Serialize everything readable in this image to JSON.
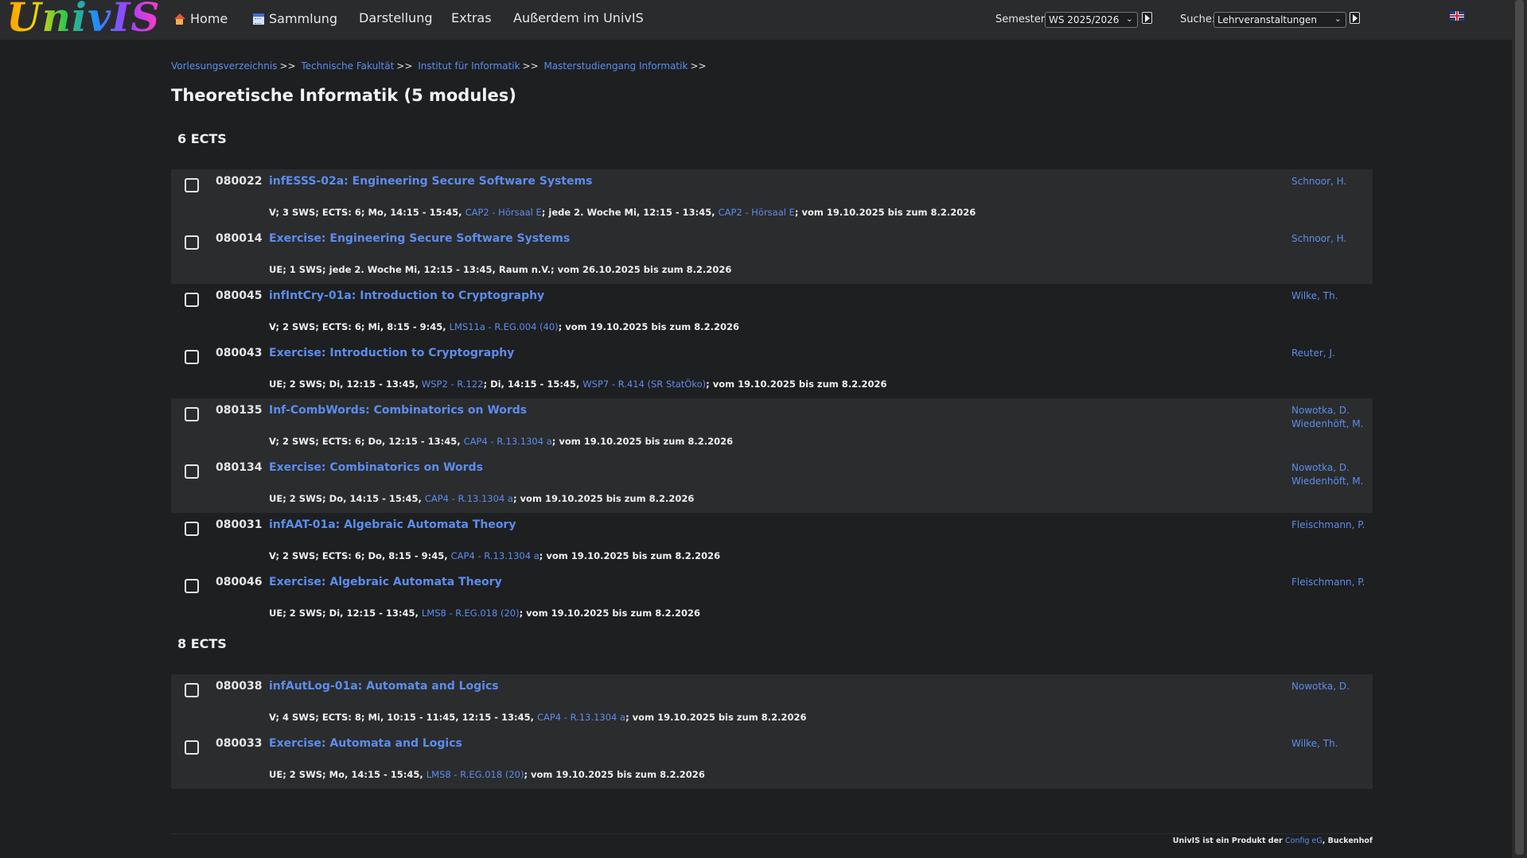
{
  "app": {
    "logo_text": "UnivIS"
  },
  "nav": {
    "items": [
      {
        "label": "Home",
        "icon": "home-icon"
      },
      {
        "label": "Sammlung",
        "icon": "calendar-icon"
      },
      {
        "label": "Darstellung"
      },
      {
        "label": "Extras"
      },
      {
        "label": "Außerdem im UnivIS"
      }
    ],
    "semester_label": "Semester:",
    "semester_value": "WS 2025/2026",
    "search_label": "Suche:",
    "search_value": "Lehrveranstaltungen",
    "language_flag": "uk-flag-icon"
  },
  "breadcrumb": [
    "Vorlesungsverzeichnis",
    "Technische Fakultät",
    "Institut für Informatik",
    "Masterstudiengang Informatik"
  ],
  "breadcrumb_sep": ">>",
  "page_title": "Theoretische Informatik (5 modules)",
  "groups": [
    {
      "heading": "6 ECTS",
      "courses": [
        {
          "number": "080022",
          "title": "infESSS-02a: Engineering Secure Software Systems",
          "lecturers": [
            "Schnoor, H."
          ],
          "details": [
            {
              "t": "V; 3 SWS; ECTS: 6; Mo, 14:15 - 15:45, "
            },
            {
              "t": "CAP2 - Hörsaal E",
              "room": true
            },
            {
              "t": "; jede 2. Woche Mi, 12:15 - 13:45, "
            },
            {
              "t": "CAP2 - Hörsaal E",
              "room": true
            },
            {
              "t": "; vom 19.10.2025 bis zum 8.2.2026"
            }
          ]
        },
        {
          "number": "080014",
          "title": "Exercise: Engineering Secure Software Systems",
          "lecturers": [
            "Schnoor, H."
          ],
          "details": [
            {
              "t": "UE; 1 SWS; jede 2. Woche Mi, 12:15 - 13:45, Raum n.V.; vom 26.10.2025 bis zum 8.2.2026"
            }
          ]
        },
        {
          "number": "080045",
          "title": "infIntCry-01a: Introduction to Cryptography",
          "lecturers": [
            "Wilke, Th."
          ],
          "details": [
            {
              "t": "V; 2 SWS; ECTS: 6; Mi, 8:15 - 9:45, "
            },
            {
              "t": "LMS11a - R.EG.004 (40)",
              "room": true
            },
            {
              "t": "; vom 19.10.2025 bis zum 8.2.2026"
            }
          ]
        },
        {
          "number": "080043",
          "title": "Exercise: Introduction to Cryptography",
          "lecturers": [
            "Reuter, J."
          ],
          "details": [
            {
              "t": "UE; 2 SWS; Di, 12:15 - 13:45, "
            },
            {
              "t": "WSP2 - R.122",
              "room": true
            },
            {
              "t": "; Di, 14:15 - 15:45, "
            },
            {
              "t": "WSP7 - R.414 (SR StatÖko)",
              "room": true
            },
            {
              "t": "; vom 19.10.2025 bis zum 8.2.2026"
            }
          ]
        },
        {
          "number": "080135",
          "title": "Inf-CombWords: Combinatorics on Words",
          "lecturers": [
            "Nowotka, D.",
            "Wiedenhöft, M."
          ],
          "details": [
            {
              "t": "V; 2 SWS; ECTS: 6; Do, 12:15 - 13:45, "
            },
            {
              "t": "CAP4 - R.13.1304 a",
              "room": true
            },
            {
              "t": "; vom 19.10.2025 bis zum 8.2.2026"
            }
          ]
        },
        {
          "number": "080134",
          "title": "Exercise: Combinatorics on Words",
          "lecturers": [
            "Nowotka, D.",
            "Wiedenhöft, M."
          ],
          "details": [
            {
              "t": "UE; 2 SWS; Do, 14:15 - 15:45, "
            },
            {
              "t": "CAP4 - R.13.1304 a",
              "room": true
            },
            {
              "t": "; vom 19.10.2025 bis zum 8.2.2026"
            }
          ]
        },
        {
          "number": "080031",
          "title": "infAAT-01a: Algebraic Automata Theory",
          "lecturers": [
            "Fleischmann, P."
          ],
          "details": [
            {
              "t": "V; 2 SWS; ECTS: 6; Do, 8:15 - 9:45, "
            },
            {
              "t": "CAP4 - R.13.1304 a",
              "room": true
            },
            {
              "t": "; vom 19.10.2025 bis zum 8.2.2026"
            }
          ]
        },
        {
          "number": "080046",
          "title": "Exercise: Algebraic Automata Theory",
          "lecturers": [
            "Fleischmann, P."
          ],
          "details": [
            {
              "t": "UE; 2 SWS; Di, 12:15 - 13:45, "
            },
            {
              "t": "LMS8 - R.EG.018 (20)",
              "room": true
            },
            {
              "t": "; vom 19.10.2025 bis zum 8.2.2026"
            }
          ]
        }
      ]
    },
    {
      "heading": "8 ECTS",
      "courses": [
        {
          "number": "080038",
          "title": "infAutLog-01a: Automata and Logics",
          "lecturers": [
            "Nowotka, D."
          ],
          "details": [
            {
              "t": "V; 4 SWS; ECTS: 8; Mi, 10:15 - 11:45, 12:15 - 13:45, "
            },
            {
              "t": "CAP4 - R.13.1304 a",
              "room": true
            },
            {
              "t": "; vom 19.10.2025 bis zum 8.2.2026"
            }
          ]
        },
        {
          "number": "080033",
          "title": "Exercise: Automata and Logics",
          "lecturers": [
            "Wilke, Th."
          ],
          "details": [
            {
              "t": "UE; 2 SWS; Mo, 14:15 - 15:45, "
            },
            {
              "t": "LMS8 - R.EG.018 (20)",
              "room": true
            },
            {
              "t": "; vom 19.10.2025 bis zum 8.2.2026"
            }
          ]
        }
      ]
    }
  ],
  "footer": {
    "text": "UnivIS ist ein Produkt der ",
    "link": "Config eG",
    "suffix": ", Buckenhof"
  },
  "colors": {
    "background": "#1e1f20",
    "band": "#2b2c2d",
    "link": "#5b8def",
    "topbar": "#2a2b2c"
  }
}
